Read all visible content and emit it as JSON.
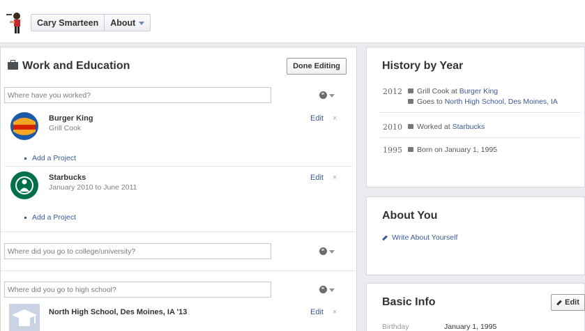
{
  "header": {
    "profile_name": "Cary Smarteen",
    "section_label": "About"
  },
  "work_education": {
    "title": "Work and Education",
    "done_label": "Done Editing",
    "work_placeholder": "Where have you worked?",
    "jobs": [
      {
        "name": "Burger King",
        "detail": "Grill Cook",
        "edit": "Edit",
        "remove": "×",
        "add_project": "Add a Project",
        "logo_text": "BURGER KING"
      },
      {
        "name": "Starbucks",
        "detail": "January 2010 to June 2011",
        "edit": "Edit",
        "remove": "×",
        "add_project": "Add a Project"
      }
    ],
    "college_placeholder": "Where did you go to college/university?",
    "highschool_placeholder": "Where did you go to high school?",
    "school": {
      "name": "North High School, Des Moines, IA '13",
      "edit": "Edit",
      "remove": "×"
    }
  },
  "history": {
    "title": "History by Year",
    "years": [
      {
        "year": "2012",
        "events": [
          {
            "prefix": "Grill Cook at ",
            "link": "Burger King",
            "icon": "briefcase-icon"
          },
          {
            "prefix": "Goes to ",
            "link": "North High School, Des Moines, IA",
            "icon": "school-icon"
          }
        ]
      },
      {
        "year": "2010",
        "events": [
          {
            "prefix": "Worked at ",
            "link": "Starbucks",
            "icon": "briefcase-icon"
          }
        ]
      },
      {
        "year": "1995",
        "events": [
          {
            "prefix": "Born on January 1, 1995",
            "link": "",
            "icon": "calendar-icon"
          }
        ]
      }
    ]
  },
  "about_you": {
    "title": "About You",
    "write_label": "Write About Yourself"
  },
  "basic_info": {
    "title": "Basic Info",
    "edit_label": "Edit",
    "rows": [
      {
        "label": "Birthday",
        "value": "January 1, 1995"
      }
    ]
  },
  "colors": {
    "link": "#3b5998",
    "page_bg": "#e9ebee",
    "panel_border": "#d3d6db"
  }
}
